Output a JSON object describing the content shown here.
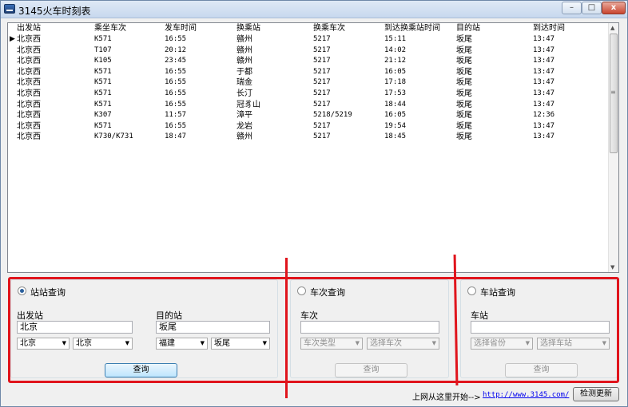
{
  "window": {
    "title": "3145火车时刻表",
    "min": "–",
    "max": "□",
    "close": "x"
  },
  "table": {
    "columns": [
      "出发站",
      "乘坐车次",
      "发车时间",
      "换乘站",
      "换乘车次",
      "到达换乘站时间",
      "目的站",
      "到达时间"
    ],
    "rows": [
      [
        "北京西",
        "K571",
        "16:55",
        "赣州",
        "5217",
        "15:11",
        "坂尾",
        "13:47"
      ],
      [
        "北京西",
        "T107",
        "20:12",
        "赣州",
        "5217",
        "14:02",
        "坂尾",
        "13:47"
      ],
      [
        "北京西",
        "K105",
        "23:45",
        "赣州",
        "5217",
        "21:12",
        "坂尾",
        "13:47"
      ],
      [
        "北京西",
        "K571",
        "16:55",
        "于都",
        "5217",
        "16:05",
        "坂尾",
        "13:47"
      ],
      [
        "北京西",
        "K571",
        "16:55",
        "瑞金",
        "5217",
        "17:18",
        "坂尾",
        "13:47"
      ],
      [
        "北京西",
        "K571",
        "16:55",
        "长汀",
        "5217",
        "17:53",
        "坂尾",
        "13:47"
      ],
      [
        "北京西",
        "K571",
        "16:55",
        "冠豸山",
        "5217",
        "18:44",
        "坂尾",
        "13:47"
      ],
      [
        "北京西",
        "K307",
        "11:57",
        "漳平",
        "5218/5219",
        "16:05",
        "坂尾",
        "12:36"
      ],
      [
        "北京西",
        "K571",
        "16:55",
        "龙岩",
        "5217",
        "19:54",
        "坂尾",
        "13:47"
      ],
      [
        "北京西",
        "K730/K731",
        "18:47",
        "赣州",
        "5217",
        "18:45",
        "坂尾",
        "13:47"
      ]
    ]
  },
  "station_query": {
    "title": "站站查询",
    "from_label": "出发站",
    "from_value": "北京",
    "to_label": "目的站",
    "to_value": "坂尾",
    "from_province": "北京",
    "from_city": "北京",
    "to_province": "福建",
    "to_city": "坂尾",
    "button": "查询"
  },
  "train_query": {
    "title": "车次查询",
    "label": "车次",
    "value": "",
    "type_select": "车次类型",
    "train_select": "选择车次",
    "button": "查询"
  },
  "stop_query": {
    "title": "车站查询",
    "label": "车站",
    "value": "",
    "province_select": "选择省份",
    "station_select": "选择车站",
    "button": "查询"
  },
  "footer": {
    "text": "上网从这里开始-->",
    "link": "http://www.3145.com/",
    "update_button": "检测更新"
  },
  "colors": {
    "annotation": "#e0141c"
  }
}
